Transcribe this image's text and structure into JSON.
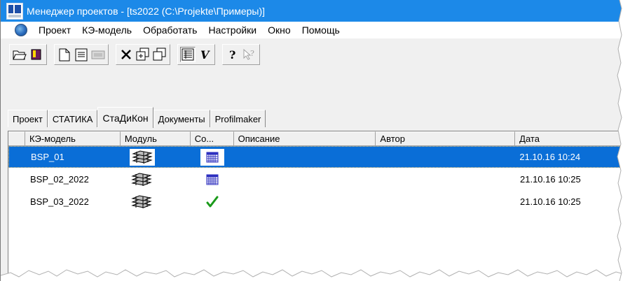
{
  "window": {
    "title": "Менеджер проектов - [ts2022 (C:\\Projekte\\Примеры)]"
  },
  "menu": {
    "items": [
      "Проект",
      "КЭ-модель",
      "Обработать",
      "Настройки",
      "Окно",
      "Помощь"
    ]
  },
  "toolbar": {
    "icons": [
      "open-folder-icon",
      "book-icon",
      "new-document-icon",
      "properties-icon",
      "disabled-keyboard-icon",
      "delete-icon",
      "copy-icon",
      "duplicate-icon",
      "list-view-icon",
      "italic-v-icon",
      "help-icon",
      "context-help-icon"
    ]
  },
  "tabs": [
    {
      "label": "Проект"
    },
    {
      "label": "СТАТИКА"
    },
    {
      "label": "СтаДиКон",
      "active": true
    },
    {
      "label": "Документы"
    },
    {
      "label": "Profilmaker"
    }
  ],
  "table": {
    "columns": [
      "КЭ-модель",
      "Модуль",
      "Со...",
      "Описание",
      "Автор",
      "Дата"
    ],
    "rows": [
      {
        "name": "BSP_01",
        "module_icon": "stack-layers-icon",
        "status_icon": "grid-table-icon",
        "description": "",
        "author": "",
        "date": "21.10.16 10:24",
        "selected": true
      },
      {
        "name": "BSP_02_2022",
        "module_icon": "stack-layers-icon",
        "status_icon": "grid-table-icon",
        "description": "",
        "author": "",
        "date": "21.10.16 10:25",
        "selected": false
      },
      {
        "name": "BSP_03_2022",
        "module_icon": "stack-layers-icon",
        "status_icon": "checkmark-icon",
        "description": "",
        "author": "",
        "date": "21.10.16 10:25",
        "selected": false
      }
    ]
  },
  "colors": {
    "titlebar": "#1c89e8",
    "selection": "#0a6ed7",
    "checkmark": "#1a9a1a",
    "grid_icon": "#2d2fbf"
  }
}
